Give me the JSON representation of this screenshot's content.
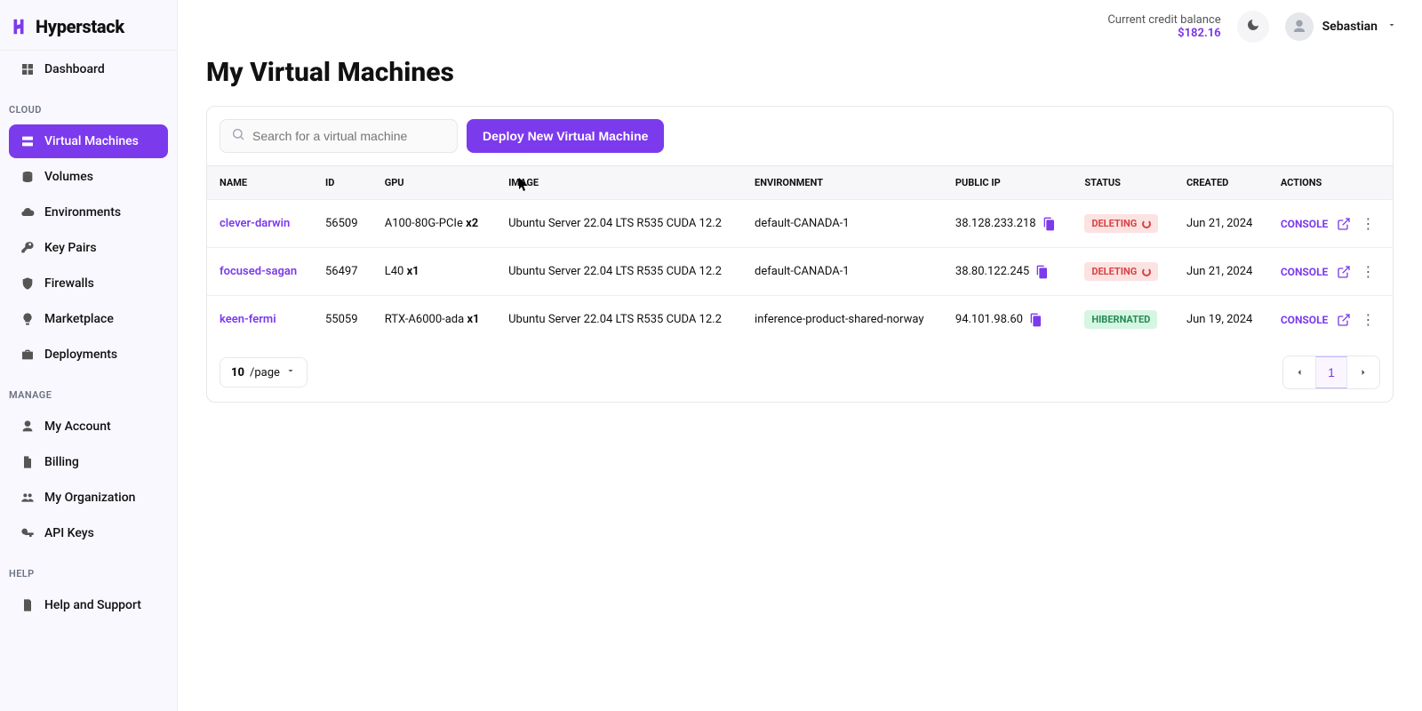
{
  "brand": "Hyperstack",
  "topbar": {
    "balance_label": "Current credit balance",
    "balance_value": "$182.16",
    "user_name": "Sebastian"
  },
  "sidebar": {
    "sections": [
      {
        "label": null,
        "items": [
          {
            "key": "dashboard",
            "label": "Dashboard",
            "icon": "grid-icon"
          }
        ]
      },
      {
        "label": "CLOUD",
        "items": [
          {
            "key": "virtual-machines",
            "label": "Virtual Machines",
            "icon": "server-icon",
            "active": true
          },
          {
            "key": "volumes",
            "label": "Volumes",
            "icon": "disk-icon"
          },
          {
            "key": "environments",
            "label": "Environments",
            "icon": "cloud-icon"
          },
          {
            "key": "key-pairs",
            "label": "Key Pairs",
            "icon": "key-icon"
          },
          {
            "key": "firewalls",
            "label": "Firewalls",
            "icon": "shield-icon"
          },
          {
            "key": "marketplace",
            "label": "Marketplace",
            "icon": "bulb-icon"
          },
          {
            "key": "deployments",
            "label": "Deployments",
            "icon": "briefcase-icon"
          }
        ]
      },
      {
        "label": "MANAGE",
        "items": [
          {
            "key": "my-account",
            "label": "My Account",
            "icon": "user-icon"
          },
          {
            "key": "billing",
            "label": "Billing",
            "icon": "file-icon"
          },
          {
            "key": "my-organization",
            "label": "My Organization",
            "icon": "users-icon"
          },
          {
            "key": "api-keys",
            "label": "API Keys",
            "icon": "key2-icon"
          }
        ]
      },
      {
        "label": "HELP",
        "items": [
          {
            "key": "help-support",
            "label": "Help and Support",
            "icon": "doc-icon"
          }
        ]
      }
    ]
  },
  "page": {
    "title": "My Virtual Machines",
    "search_placeholder": "Search for a virtual machine",
    "deploy_button": "Deploy New Virtual Machine",
    "console_label": "CONSOLE",
    "page_size_value": "10",
    "page_size_suffix": "/page",
    "current_page": "1",
    "columns": [
      "NAME",
      "ID",
      "GPU",
      "IMAGE",
      "ENVIRONMENT",
      "PUBLIC IP",
      "STATUS",
      "CREATED",
      "ACTIONS"
    ],
    "rows": [
      {
        "name": "clever-darwin",
        "id": "56509",
        "gpu_model": "A100-80G-PCIe",
        "gpu_qty": "x2",
        "image": "Ubuntu Server 22.04 LTS R535 CUDA 12.2",
        "environment": "default-CANADA-1",
        "public_ip": "38.128.233.218",
        "status": "DELETING",
        "created": "Jun 21, 2024"
      },
      {
        "name": "focused-sagan",
        "id": "56497",
        "gpu_model": "L40",
        "gpu_qty": "x1",
        "image": "Ubuntu Server 22.04 LTS R535 CUDA 12.2",
        "environment": "default-CANADA-1",
        "public_ip": "38.80.122.245",
        "status": "DELETING",
        "created": "Jun 21, 2024"
      },
      {
        "name": "keen-fermi",
        "id": "55059",
        "gpu_model": "RTX-A6000-ada",
        "gpu_qty": "x1",
        "image": "Ubuntu Server 22.04 LTS R535 CUDA 12.2",
        "environment": "inference-product-shared-norway",
        "public_ip": "94.101.98.60",
        "status": "HIBERNATED",
        "created": "Jun 19, 2024"
      }
    ]
  }
}
